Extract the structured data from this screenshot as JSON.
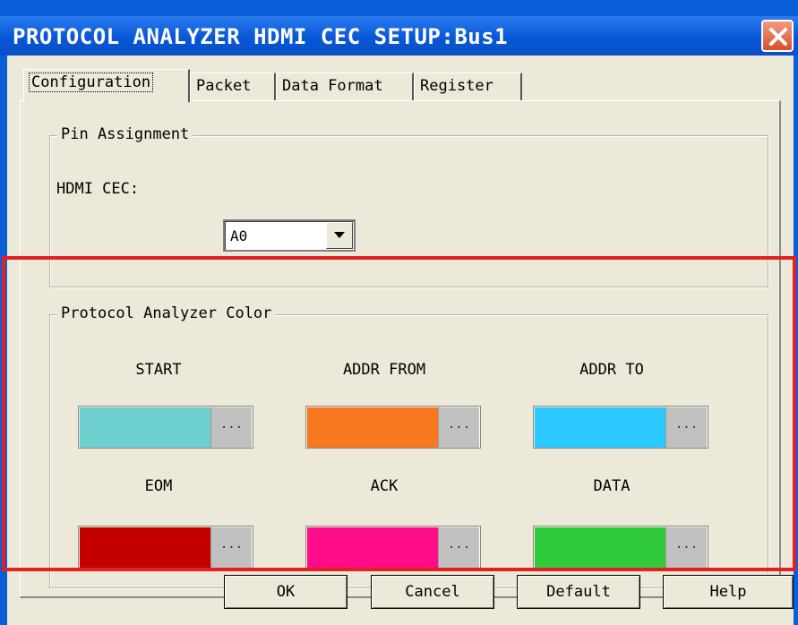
{
  "window": {
    "title": "PROTOCOL ANALYZER HDMI CEC SETUP:Bus1"
  },
  "tabs": [
    {
      "label": "Configuration",
      "active": true
    },
    {
      "label": "Packet",
      "active": false
    },
    {
      "label": "Data Format",
      "active": false
    },
    {
      "label": "Register",
      "active": false
    }
  ],
  "pin_assignment": {
    "legend": "Pin Assignment",
    "field_label": "HDMI CEC:",
    "selected": "A0"
  },
  "color_group": {
    "legend": "Protocol Analyzer Color",
    "items": [
      {
        "label": "START",
        "color": "#6ecfcf",
        "more": "..."
      },
      {
        "label": "ADDR FROM",
        "color": "#f7781f",
        "more": "..."
      },
      {
        "label": "ADDR TO",
        "color": "#2bc8ff",
        "more": "..."
      },
      {
        "label": "EOM",
        "color": "#c50000",
        "more": "..."
      },
      {
        "label": "ACK",
        "color": "#ff0c8a",
        "more": "..."
      },
      {
        "label": "DATA",
        "color": "#2fcb3a",
        "more": "..."
      }
    ]
  },
  "buttons": {
    "ok": "OK",
    "cancel": "Cancel",
    "default": "Default",
    "help": "Help"
  },
  "highlight_color": "#e51f1f"
}
